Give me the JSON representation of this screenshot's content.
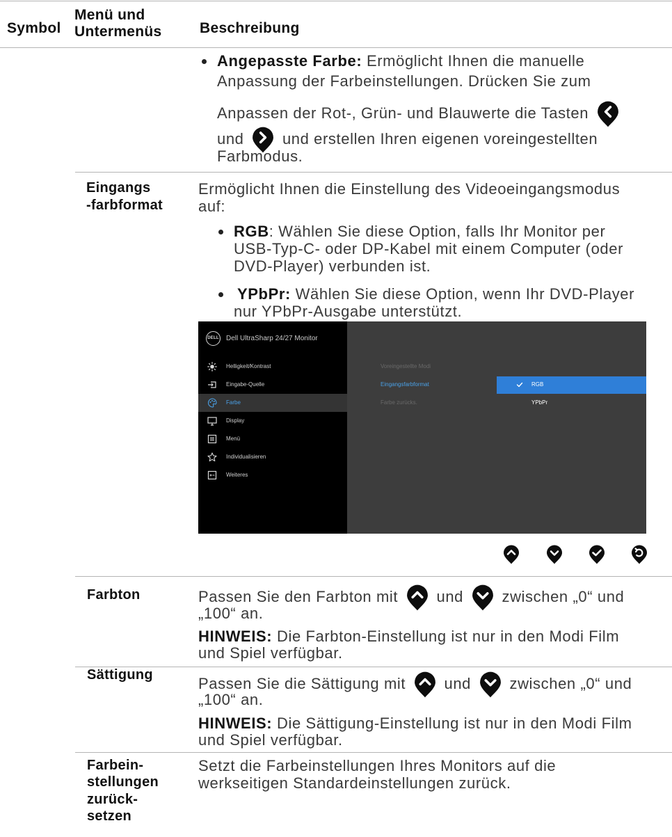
{
  "header": {
    "symbol": "Symbol",
    "menu_line1": "Menü und",
    "menu_line2": "Untermenüs",
    "description": "Beschreibung"
  },
  "custom_color": {
    "label": "Angepasste Farbe:",
    "lines": [
      " Ermöglicht Ihnen die manuelle",
      "Anpassung der Farbeinstellungen. Drücken Sie zum",
      "Anpassen der Rot-, Grün- und Blauwerte die Tasten",
      "und",
      "und erstellen Ihren eigenen voreingestellten",
      "Farbmodus."
    ],
    "icons": [
      "left-button-icon",
      "right-button-icon"
    ]
  },
  "input_format": {
    "name": [
      "Eingangs",
      "-farbformat"
    ],
    "intro": [
      "Ermöglicht Ihnen die Einstellung des Videoeingangsmodus",
      "auf:"
    ],
    "rgb_label": "RGB",
    "rgb_lines": [
      ": Wählen Sie diese Option, falls Ihr Monitor per",
      "USB-Typ-C- oder DP-Kabel mit einem Computer (oder",
      "DVD-Player) verbunden ist."
    ],
    "ypbpr_label": "YPbPr:",
    "ypbpr_lines": [
      " Wählen Sie diese Option, wenn Ihr DVD-Player",
      "nur YPbPr-Ausgabe unterstützt."
    ]
  },
  "osd": {
    "logo": "DELL",
    "title": "Dell UltraSharp 24/27 Monitor",
    "menu": [
      {
        "label": "Helligkeit/Kontrast",
        "icon": "brightness-icon"
      },
      {
        "label": "Eingabe-Quelle",
        "icon": "input-source-icon"
      },
      {
        "label": "Farbe",
        "icon": "color-icon",
        "active": true
      },
      {
        "label": "Display",
        "icon": "display-icon"
      },
      {
        "label": "Menü",
        "icon": "menu-icon"
      },
      {
        "label": "Individualisieren",
        "icon": "star-icon"
      },
      {
        "label": "Weiteres",
        "icon": "others-icon"
      }
    ],
    "submenu": [
      {
        "label": "Voreingestellte Modi",
        "state": "disabled"
      },
      {
        "label": "Eingangsfarbformat",
        "state": "active"
      },
      {
        "label": "Farbe zurücks.",
        "state": "disabled"
      }
    ],
    "options": [
      {
        "label": "RGB",
        "selected": true
      },
      {
        "label": "YPbPr",
        "selected": false
      }
    ],
    "colors": {
      "left_panel": "#000000",
      "right_panel": "#3d3d3d",
      "highlight": "#2f7fd8",
      "active_text": "#4aa0e6"
    },
    "buttons": [
      "up-button-icon",
      "down-button-icon",
      "check-button-icon",
      "back-button-icon"
    ]
  },
  "hue": {
    "name": "Farbton",
    "line1": [
      "Passen Sie den Farbton mit",
      "und",
      "zwischen „0“ und"
    ],
    "line2": "„100“ an.",
    "note_label": "HINWEIS:",
    "note_lines": [
      " Die Farbton-Einstellung ist nur in den Modi Film",
      "und Spiel verfügbar."
    ],
    "icons": [
      "up-button-icon",
      "down-button-icon"
    ]
  },
  "saturation": {
    "name": "Sättigung",
    "line1": [
      "Passen Sie die Sättigung mit",
      "und",
      "zwischen „0“ und"
    ],
    "line2": "„100“ an.",
    "note_label": "HINWEIS:",
    "note_lines": [
      " Die Sättigung-Einstellung ist nur in den Modi Film",
      "und Spiel verfügbar."
    ],
    "icons": [
      "up-button-icon",
      "down-button-icon"
    ]
  },
  "reset_color": {
    "name": [
      "Farbein-",
      "stellungen",
      "zurück-",
      "setzen"
    ],
    "lines": [
      "Setzt die Farbeinstellungen Ihres Monitors auf die",
      "werkseitigen Standardeinstellungen zurück."
    ]
  }
}
